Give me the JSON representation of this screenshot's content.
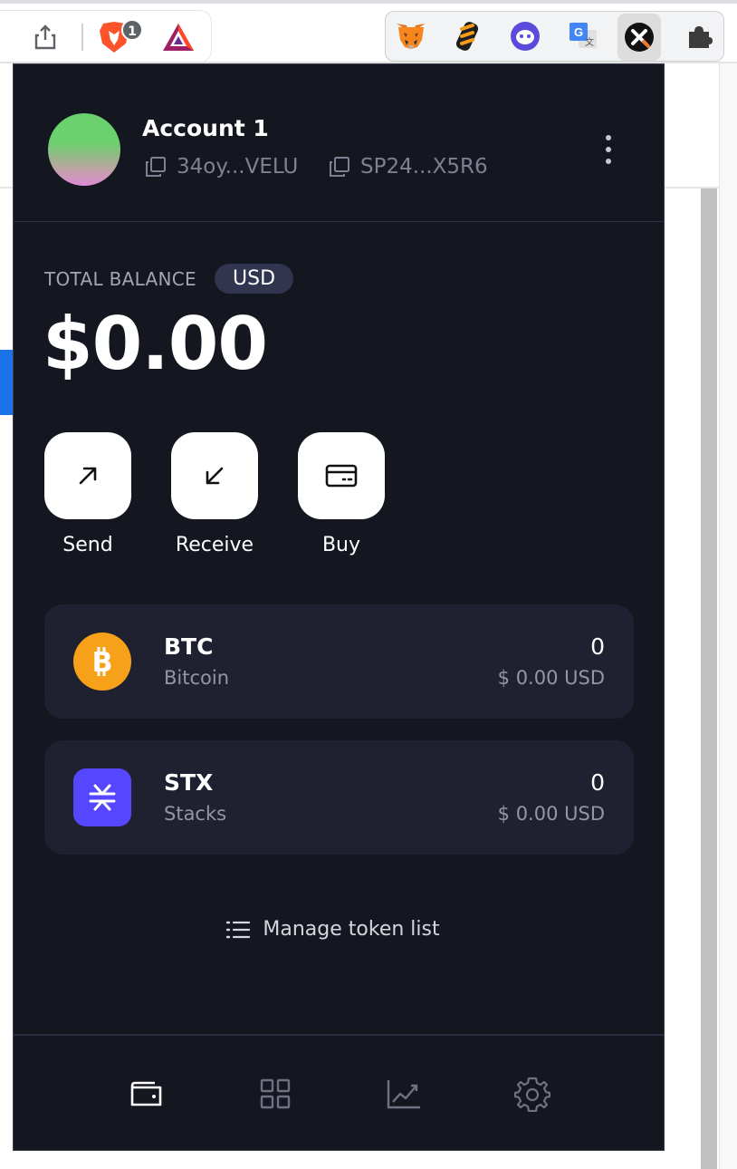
{
  "browser": {
    "brave_badge_count": "1",
    "extensions": [
      "metamask-icon",
      "sequence-icon",
      "ghost-wallet-icon",
      "google-translate-icon",
      "xverse-icon",
      "puzzle-extensions-icon"
    ]
  },
  "account": {
    "name": "Account 1",
    "btc_address": "34oy...VELU",
    "stx_address": "SP24...X5R6"
  },
  "balance": {
    "label": "TOTAL BALANCE",
    "currency": "USD",
    "amount": "$0.00"
  },
  "actions": [
    {
      "label": "Send"
    },
    {
      "label": "Receive"
    },
    {
      "label": "Buy"
    }
  ],
  "tokens": [
    {
      "symbol": "BTC",
      "name": "Bitcoin",
      "amount": "0",
      "usd": "$ 0.00 USD"
    },
    {
      "symbol": "STX",
      "name": "Stacks",
      "amount": "0",
      "usd": "$ 0.00 USD"
    }
  ],
  "manage_tokens": "Manage token list",
  "nav": [
    "wallet-icon",
    "grid-icon",
    "chart-icon",
    "settings-icon"
  ],
  "colors": {
    "popup_bg": "#141620",
    "card_bg": "#1f2131",
    "btc": "#f7a11b",
    "stx": "#5546ff",
    "badge_bg": "#32354f"
  }
}
